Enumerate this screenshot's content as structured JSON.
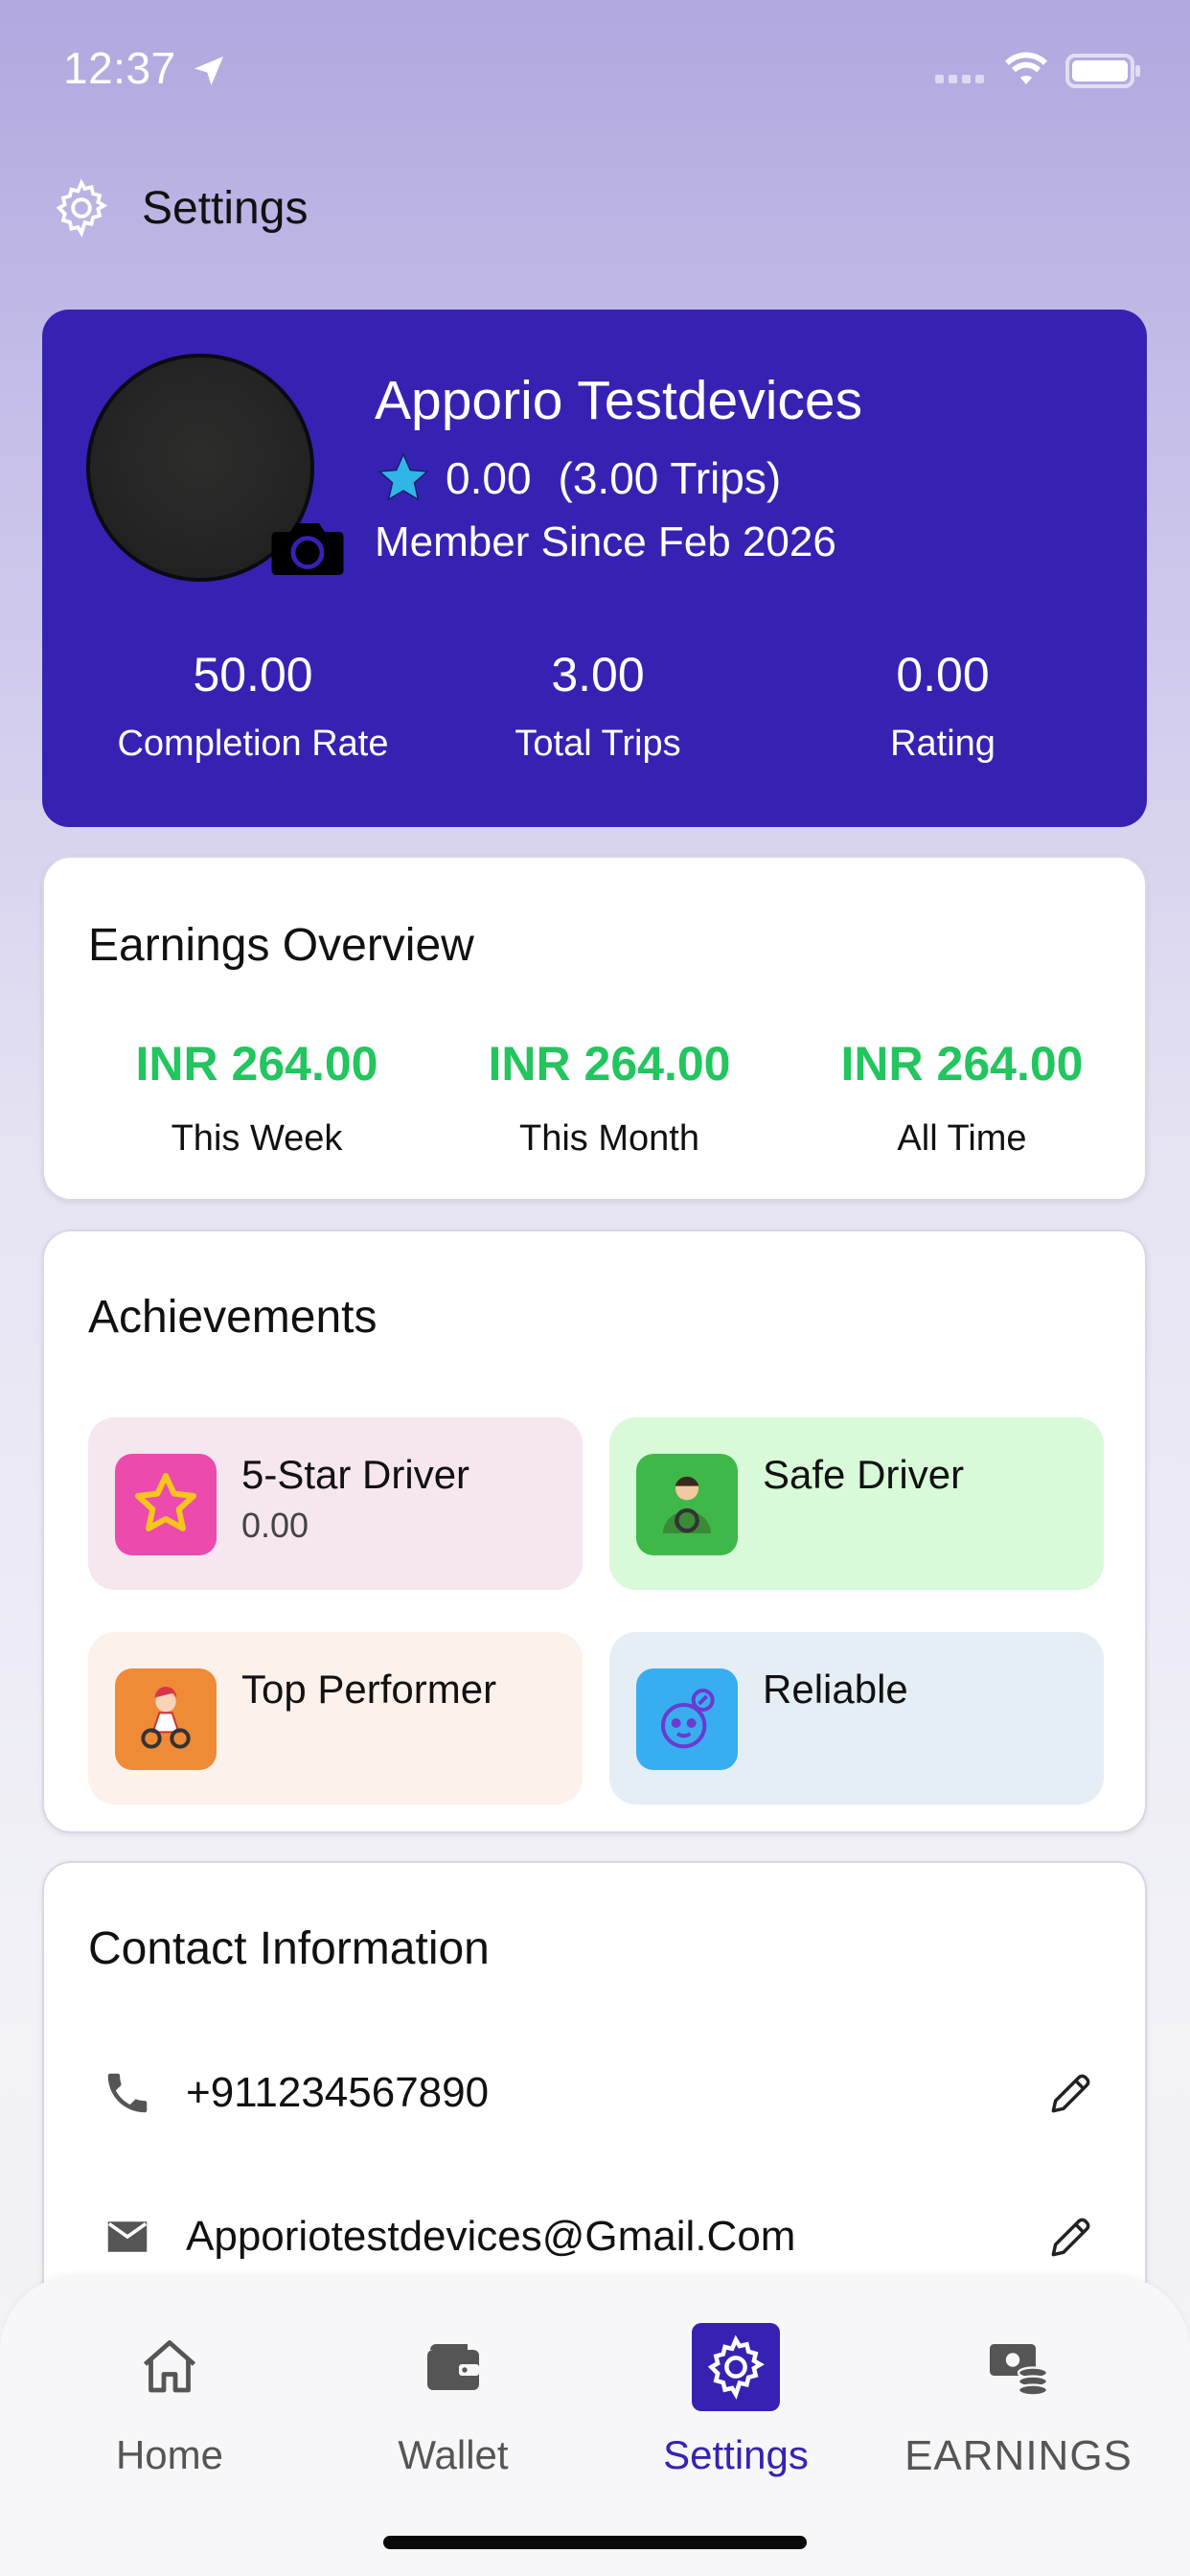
{
  "status_bar": {
    "time": "12:37"
  },
  "header": {
    "title": "Settings"
  },
  "profile": {
    "name": "Apporio Testdevices",
    "rating": "0.00",
    "trips": "(3.00 Trips)",
    "member_since": "Member Since Feb 2026",
    "stats": [
      {
        "value": "50.00",
        "label": "Completion Rate"
      },
      {
        "value": "3.00",
        "label": "Total Trips"
      },
      {
        "value": "0.00",
        "label": "Rating"
      }
    ]
  },
  "earnings": {
    "title": "Earnings Overview",
    "items": [
      {
        "amount": "INR 264.00",
        "label": "This Week"
      },
      {
        "amount": "INR 264.00",
        "label": "This Month"
      },
      {
        "amount": "INR 264.00",
        "label": "All Time"
      }
    ]
  },
  "achievements": {
    "title": "Achievements",
    "items": [
      {
        "title": "5-Star Driver",
        "subtitle": "0.00",
        "icon": "star-icon",
        "tile_color": "#f5e6f0",
        "icon_color": "#ec4aad"
      },
      {
        "title": "Safe Driver",
        "subtitle": "",
        "icon": "driver-icon",
        "tile_color": "#d8fad8",
        "icon_color": "#3fb84a"
      },
      {
        "title": "Top Performer",
        "subtitle": "",
        "icon": "performer-icon",
        "tile_color": "#fdf1ec",
        "icon_color": "#ef8a37"
      },
      {
        "title": "Reliable",
        "subtitle": "",
        "icon": "reliable-icon",
        "tile_color": "#e6eef5",
        "icon_color": "#38aef0"
      }
    ]
  },
  "contact": {
    "title": "Contact Information",
    "phone": "+911234567890",
    "email": "Apporiotestdevices@Gmail.Com"
  },
  "nav": {
    "items": [
      {
        "label": "Home",
        "icon": "home-icon"
      },
      {
        "label": "Wallet",
        "icon": "wallet-icon"
      },
      {
        "label": "Settings",
        "icon": "gear-icon",
        "active": true
      },
      {
        "label": "EARNINGS",
        "icon": "earnings-icon"
      }
    ]
  },
  "colors": {
    "brand": "#3622b2",
    "earnings_green": "#22c55e"
  }
}
